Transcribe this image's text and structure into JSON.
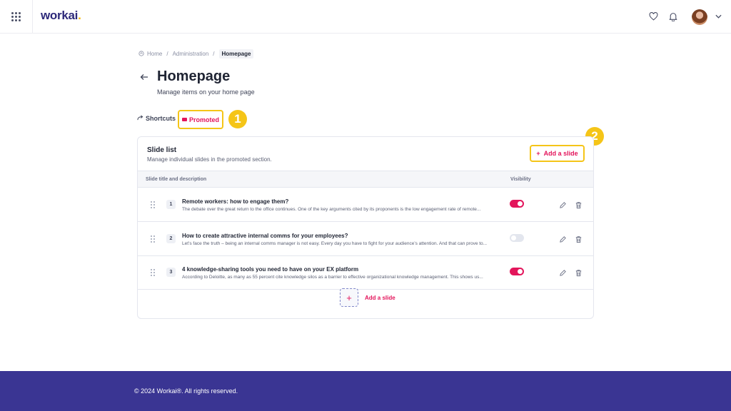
{
  "header": {
    "logo_text": "workai",
    "logo_dot": ".",
    "icons": [
      "apps-grid-icon",
      "heart-icon",
      "bell-icon",
      "avatar",
      "chevron-down-icon"
    ]
  },
  "breadcrumb": {
    "home": "Home",
    "administration": "Administration",
    "current": "Homepage",
    "separator": "/"
  },
  "page": {
    "title": "Homepage",
    "subtitle": "Manage items on your home page"
  },
  "tabs": {
    "shortcuts": "Shortcuts",
    "promoted": "Promoted"
  },
  "callouts": {
    "one": "1",
    "two": "2"
  },
  "slide_list": {
    "title": "Slide list",
    "description": "Manage individual slides in the promoted section.",
    "add_button": "Add a slide",
    "add_button_icon": "+",
    "columns": {
      "title": "Slide title and description",
      "visibility": "Visibility"
    },
    "rows": [
      {
        "number": "1",
        "title": "Remote workers: how to engage them?",
        "description": "The debate over the great return to the office continues. One of the key arguments cited by its proponents is the low engagement rate of remote...",
        "visible": true
      },
      {
        "number": "2",
        "title": "How to create attractive internal comms for your employees?",
        "description": "Let’s face the truth – being an internal comms manager is not easy. Every day you have to fight for your audience’s attention. And that can prove to...",
        "visible": false
      },
      {
        "number": "3",
        "title": "4 knowledge-sharing tools you need to have on your EX platform",
        "description": "According to Deloitte, as many as 55 percent cite knowledge silos as a barrier to effective organizational knowledge management. This shows us...",
        "visible": true
      }
    ],
    "add_row_icon": "+",
    "add_row_label": "Add a slide"
  },
  "footer": {
    "copyright": "© 2024 Workai®. All rights reserved."
  },
  "colors": {
    "accent": "#e3155b",
    "highlight": "#f5c518",
    "brand": "#2e2a7a",
    "footer": "#3a3593"
  }
}
